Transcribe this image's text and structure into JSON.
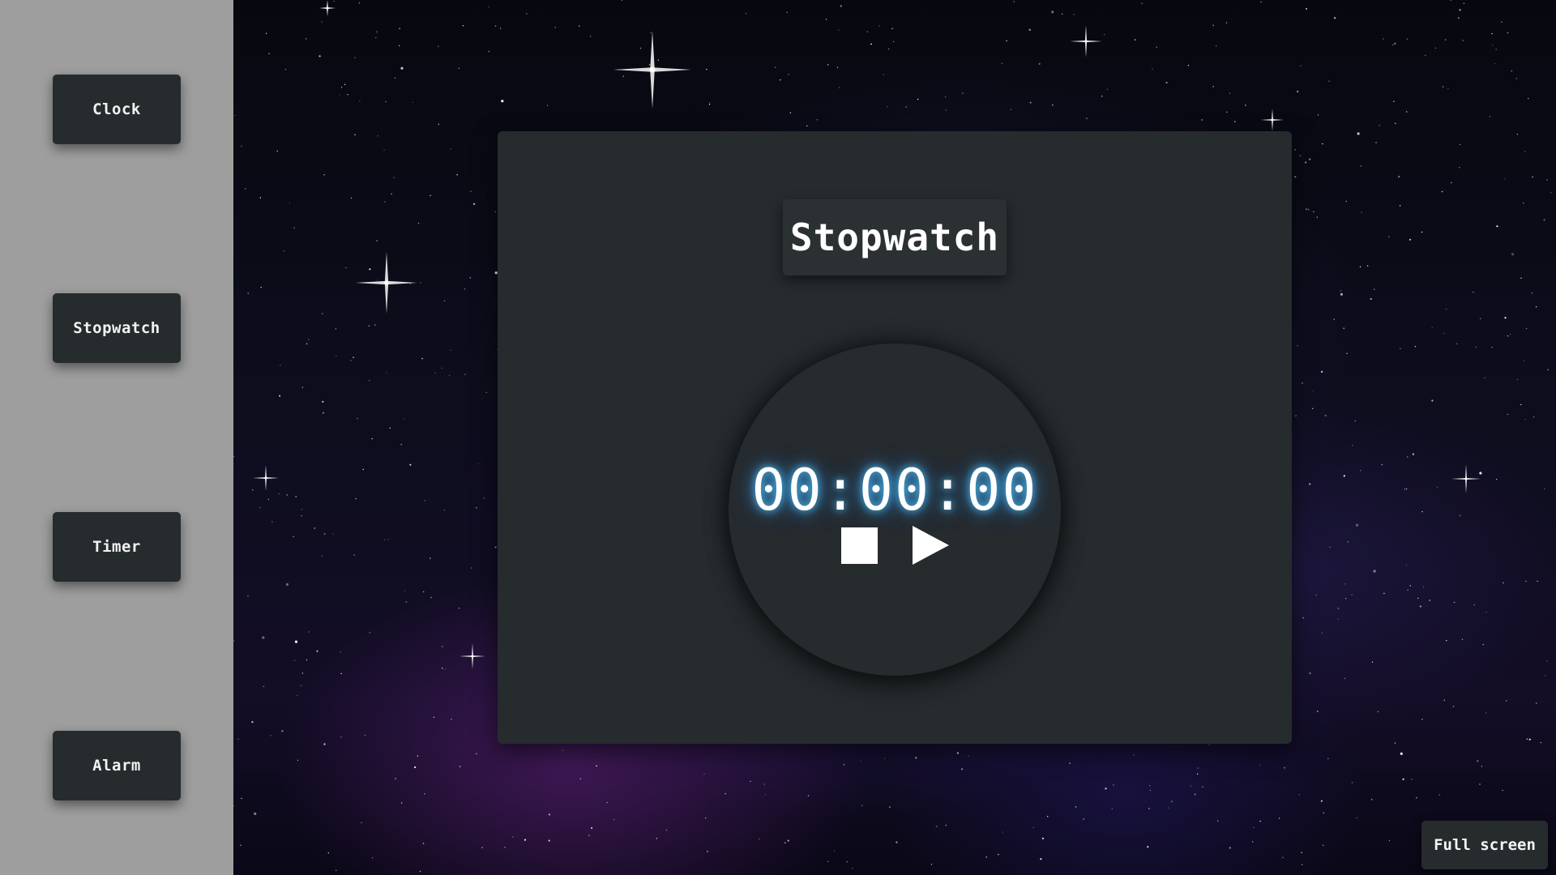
{
  "sidebar": {
    "items": [
      {
        "label": "Clock"
      },
      {
        "label": "Stopwatch"
      },
      {
        "label": "Timer"
      },
      {
        "label": "Alarm"
      }
    ]
  },
  "main": {
    "title": "Stopwatch",
    "display_time": "00:00:00",
    "controls": {
      "stop_icon": "stop-icon",
      "play_icon": "play-icon"
    }
  },
  "fullscreen_label": "Full screen",
  "colors": {
    "sidebar_bg": "#9e9e9e",
    "panel_bg": "#262b2e",
    "text": "#ffffff",
    "time_glow": "#50c8ff"
  }
}
